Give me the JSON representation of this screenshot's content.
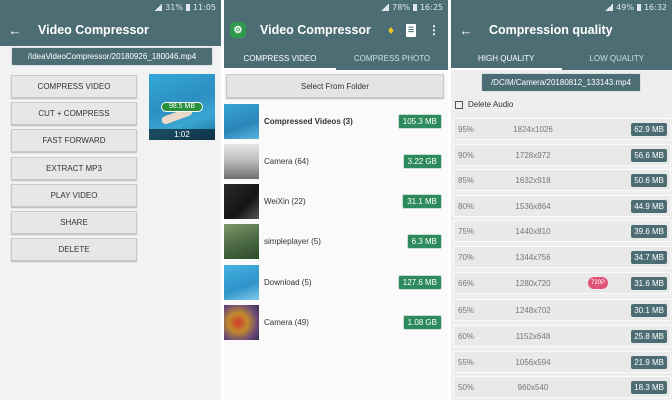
{
  "panel1": {
    "status": {
      "battery": "31%",
      "time": "11:05"
    },
    "title": "Video Compressor",
    "file_path": "/IdeaVideoCompressor/20180926_180046.mp4",
    "buttons": [
      "COMPRESS VIDEO",
      "CUT + COMPRESS",
      "FAST FORWARD",
      "EXTRACT MP3",
      "PLAY VIDEO",
      "SHARE",
      "DELETE"
    ],
    "thumbnail": {
      "size": "98.5 MB",
      "duration": "1:02"
    }
  },
  "panel2": {
    "status": {
      "battery": "78%",
      "time": "16:25"
    },
    "title": "Video Compressor",
    "tabs": [
      "COMPRESS VIDEO",
      "COMPRESS PHOTO"
    ],
    "select_button": "Select From Folder",
    "folders": [
      {
        "name": "Compressed Videos (3)",
        "size": "105.3 MB",
        "bold": true
      },
      {
        "name": "Camera (64)",
        "size": "3.22 GB"
      },
      {
        "name": "WeiXin (22)",
        "size": "31.1 MB"
      },
      {
        "name": "simpleplayer (5)",
        "size": "6.3 MB"
      },
      {
        "name": "Download (5)",
        "size": "127.6 MB"
      },
      {
        "name": "Camera (49)",
        "size": "1.08 GB"
      }
    ]
  },
  "panel3": {
    "status": {
      "battery": "49%",
      "time": "16:32"
    },
    "title": "Compression quality",
    "tabs": [
      "HIGH QUALITY",
      "LOW QUALITY"
    ],
    "file_path": "/DCIM/Camera/20180812_133143.mp4",
    "delete_audio": "Delete Audio",
    "rows": [
      {
        "pct": "95%",
        "res": "1824x1026",
        "size": "62.9 MB",
        "tag": ""
      },
      {
        "pct": "90%",
        "res": "1728x972",
        "size": "56.6 MB",
        "tag": ""
      },
      {
        "pct": "85%",
        "res": "1632x918",
        "size": "50.6 MB",
        "tag": ""
      },
      {
        "pct": "80%",
        "res": "1536x864",
        "size": "44.9 MB",
        "tag": ""
      },
      {
        "pct": "75%",
        "res": "1440x810",
        "size": "39.6 MB",
        "tag": ""
      },
      {
        "pct": "70%",
        "res": "1344x756",
        "size": "34.7 MB",
        "tag": ""
      },
      {
        "pct": "66%",
        "res": "1280x720",
        "size": "31.6 MB",
        "tag": "720P"
      },
      {
        "pct": "65%",
        "res": "1248x702",
        "size": "30.1 MB",
        "tag": ""
      },
      {
        "pct": "60%",
        "res": "1152x648",
        "size": "25.8 MB",
        "tag": ""
      },
      {
        "pct": "55%",
        "res": "1056x594",
        "size": "21.9 MB",
        "tag": ""
      },
      {
        "pct": "50%",
        "res": "960x540",
        "size": "18.3 MB",
        "tag": ""
      }
    ]
  },
  "colors": {
    "appbar": "#4c6d74",
    "size_badge": "#2d8a5c",
    "tag": "#e2537a"
  },
  "icons": [
    "back-arrow-icon",
    "app-logo-icon",
    "crown-icon",
    "document-icon",
    "more-vert-icon",
    "signal-icon",
    "battery-icon"
  ]
}
